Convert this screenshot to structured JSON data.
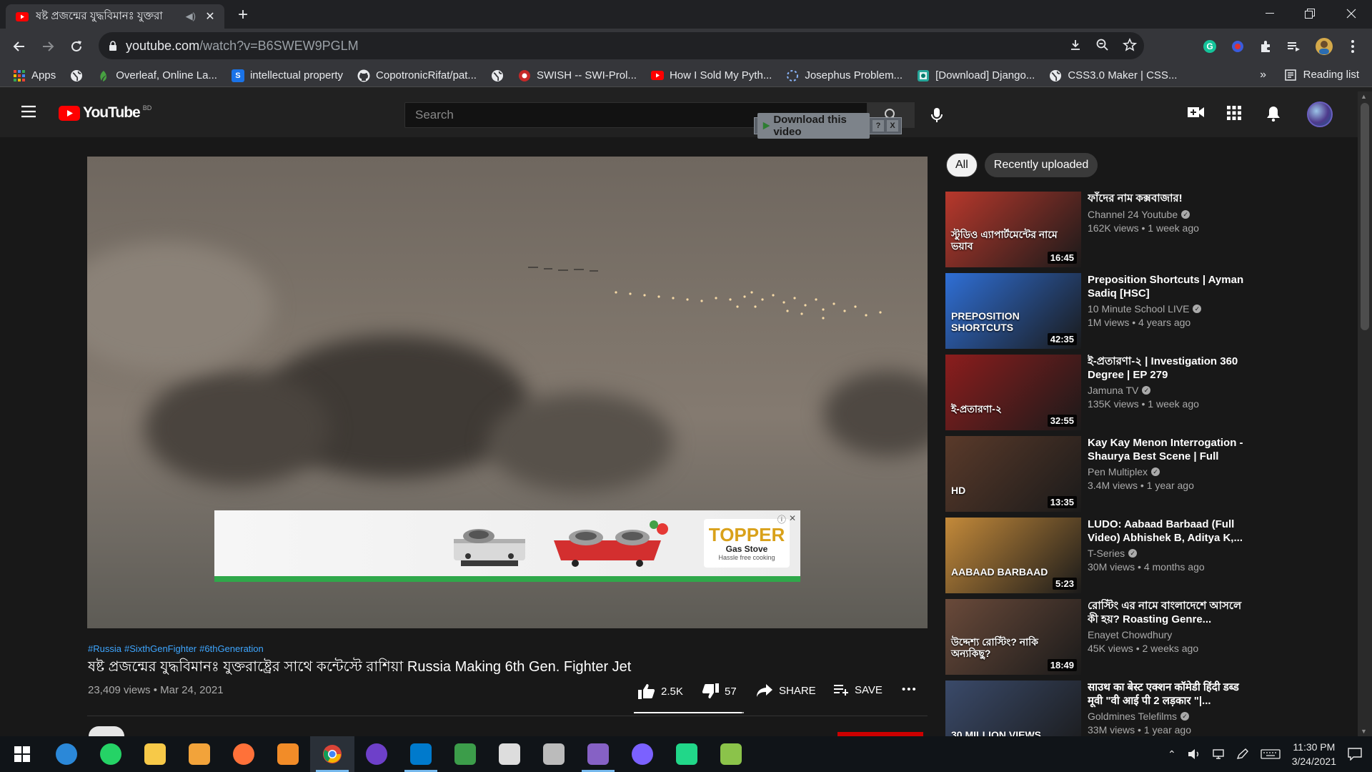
{
  "browser": {
    "tab_title": "ষষ্ট প্রজন্মের যুদ্ধবিমানঃ যুক্তরা",
    "url_host": "youtube.com",
    "url_path": "/watch?v=B6SWEW9PGLM",
    "bookmarks": [
      {
        "label": "Apps",
        "icon": "apps-grid-icon",
        "color": "#ea4335"
      },
      {
        "label": "",
        "icon": "globe-icon",
        "color": "#e8eaed"
      },
      {
        "label": "Overleaf, Online La...",
        "icon": "overleaf-icon",
        "color": "#47a141"
      },
      {
        "label": "intellectual property",
        "icon": "s-icon",
        "color": "#1a73e8"
      },
      {
        "label": "CopotronicRifat/pat...",
        "icon": "github-icon",
        "color": "#e8eaed"
      },
      {
        "label": "",
        "icon": "globe-icon",
        "color": "#e8eaed"
      },
      {
        "label": "SWISH -- SWI-Prol...",
        "icon": "swish-icon",
        "color": "#c62828"
      },
      {
        "label": "How I Sold My Pyth...",
        "icon": "youtube-icon",
        "color": "#ff0000"
      },
      {
        "label": "Josephus Problem...",
        "icon": "loading-icon",
        "color": "#8ab4f8"
      },
      {
        "label": "[Download] Django...",
        "icon": "image-icon",
        "color": "#26a69a"
      },
      {
        "label": "CSS3.0 Maker | CSS...",
        "icon": "globe-icon",
        "color": "#e8eaed"
      }
    ],
    "bookmarks_more": "»",
    "reading_list": "Reading list"
  },
  "youtube": {
    "logo_text": "YouTube",
    "country_code": "BD",
    "search_placeholder": "Search",
    "download_overlay": {
      "label": "Download this video",
      "help": "?",
      "close": "X"
    }
  },
  "ad": {
    "brand": "TOPPER",
    "product": "Gas Stove",
    "tagline": "Hassle free cooking"
  },
  "video": {
    "hashtags": [
      "#Russia",
      "#SixthGenFighter",
      "#6thGeneration"
    ],
    "title": "ষষ্ট প্রজন্মের যুদ্ধবিমানঃ যুক্তরাষ্ট্রের সাথে কন্টেস্টে রাশিয়া Russia Making 6th Gen. Fighter Jet",
    "views": "23,409 views",
    "date": "Mar 24, 2021",
    "likes": "2.5K",
    "dislikes": "57",
    "share_label": "SHARE",
    "save_label": "SAVE",
    "more_label": "•••",
    "like_ratio": 0.978
  },
  "chips": [
    {
      "label": "All",
      "active": true
    },
    {
      "label": "Recently uploaded",
      "active": false
    }
  ],
  "recommendations": [
    {
      "title": "ফাঁদের নাম কক্সবাজার!",
      "channel": "Channel 24 Youtube",
      "verified": true,
      "views": "162K views",
      "age": "1 week ago",
      "duration": "16:45",
      "thumb_text": "স্টুডিও এ্যাপার্টমেন্টের নামে ভয়াব",
      "thumb_color": "#b8382c"
    },
    {
      "title": "Preposition Shortcuts | Ayman Sadiq [HSC]",
      "channel": "10 Minute School LIVE",
      "verified": true,
      "views": "1M views",
      "age": "4 years ago",
      "duration": "42:35",
      "thumb_text": "PREPOSITION SHORTCUTS",
      "thumb_color": "#2f6fd6"
    },
    {
      "title": "ই-প্রতারণা-২ | Investigation 360 Degree | EP 279",
      "channel": "Jamuna TV",
      "verified": true,
      "views": "135K views",
      "age": "1 week ago",
      "duration": "32:55",
      "thumb_text": "ই-প্রতারণা-২",
      "thumb_color": "#8c1d1d"
    },
    {
      "title": "Kay Kay Menon Interrogation - Shaurya Best Scene | Full Hind...",
      "channel": "Pen Multiplex",
      "verified": true,
      "views": "3.4M views",
      "age": "1 year ago",
      "duration": "13:35",
      "thumb_text": "HD",
      "thumb_color": "#5a3a2a"
    },
    {
      "title": "LUDO: Aabaad Barbaad (Full Video) Abhishek B, Aditya K,...",
      "channel": "T-Series",
      "verified": true,
      "views": "30M views",
      "age": "4 months ago",
      "duration": "5:23",
      "thumb_text": "AABAAD BARBAAD",
      "thumb_color": "#c48a3a"
    },
    {
      "title": "রোস্টিং এর নামে বাংলাদেশে আসলে কী হয়? Roasting Genre...",
      "channel": "Enayet Chowdhury",
      "verified": false,
      "views": "45K views",
      "age": "2 weeks ago",
      "duration": "18:49",
      "thumb_text": "উদ্দেশ্য রোস্টিং? নাকি অন্যকিছু?",
      "thumb_color": "#6a4a3a"
    },
    {
      "title": "साउथ का बेस्ट एक्शन कॉमेडी हिंदी डब्ड मूवी \"वी आई पी 2 लड़कार \"|...",
      "channel": "Goldmines Telefilms",
      "verified": true,
      "views": "33M views",
      "age": "1 year ago",
      "duration": "",
      "thumb_text": "30 MILLION VIEWS",
      "thumb_color": "#3a4a6a"
    }
  ],
  "taskbar": {
    "apps": [
      {
        "name": "start-icon",
        "color": "#ffffff"
      },
      {
        "name": "cortana-icon",
        "color": "#2b88d8"
      },
      {
        "name": "whatsapp-icon",
        "color": "#25d366"
      },
      {
        "name": "file-explorer-icon",
        "color": "#f7c948"
      },
      {
        "name": "shield-app-icon",
        "color": "#f2a33a"
      },
      {
        "name": "firefox-icon",
        "color": "#ff7139"
      },
      {
        "name": "sublime-icon",
        "color": "#f28c28"
      },
      {
        "name": "chrome-icon",
        "color": "#db4437"
      },
      {
        "name": "github-desktop-icon",
        "color": "#6e40c9"
      },
      {
        "name": "vscode-icon",
        "color": "#007acc"
      },
      {
        "name": "earth-icon",
        "color": "#3c9d4a"
      },
      {
        "name": "weather-icon",
        "color": "#dddddd"
      },
      {
        "name": "satellite-icon",
        "color": "#bbbbbb"
      },
      {
        "name": "visual-studio-icon",
        "color": "#8661c5"
      },
      {
        "name": "messenger-icon",
        "color": "#7b61ff"
      },
      {
        "name": "pycharm-icon",
        "color": "#21d789"
      },
      {
        "name": "notepad-icon",
        "color": "#8bc34a"
      }
    ],
    "time": "11:30 PM",
    "date": "3/24/2021"
  }
}
